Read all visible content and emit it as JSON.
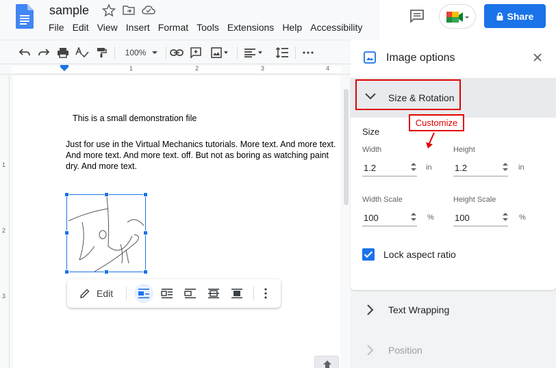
{
  "doc": {
    "title": "sample",
    "menu": [
      "File",
      "Edit",
      "View",
      "Insert",
      "Format",
      "Tools",
      "Extensions",
      "Help",
      "Accessibility"
    ]
  },
  "header": {
    "share_label": "Share",
    "share_color": "#1a73e8"
  },
  "toolbar": {
    "zoom": "100%"
  },
  "ruler": {
    "h_marks": [
      "1",
      "2",
      "3",
      "4"
    ],
    "v_marks": [
      "1",
      "2",
      "3"
    ]
  },
  "document": {
    "para1": "This is a small demonstration file",
    "para2": "Just for use in the Virtual Mechanics tutorials. More text. And more text. And more text. And more text. off. But not as boring as watching paint dry. And more text."
  },
  "image_toolbar": {
    "edit_label": "Edit"
  },
  "panel": {
    "title": "Image options",
    "size_rotation": {
      "header": "Size & Rotation",
      "annotation": "Customize",
      "size_label": "Size",
      "width_label": "Width",
      "width_value": "1.2",
      "width_unit": "in",
      "height_label": "Height",
      "height_value": "1.2",
      "height_unit": "in",
      "width_scale_label": "Width Scale",
      "width_scale_value": "100",
      "width_scale_unit": "%",
      "height_scale_label": "Height Scale",
      "height_scale_value": "100",
      "height_scale_unit": "%",
      "lock_label": "Lock aspect ratio",
      "lock_checked": true
    },
    "text_wrapping": "Text Wrapping",
    "position": "Position"
  },
  "colors": {
    "accent": "#1a73e8",
    "annotation_red": "#e00000"
  }
}
